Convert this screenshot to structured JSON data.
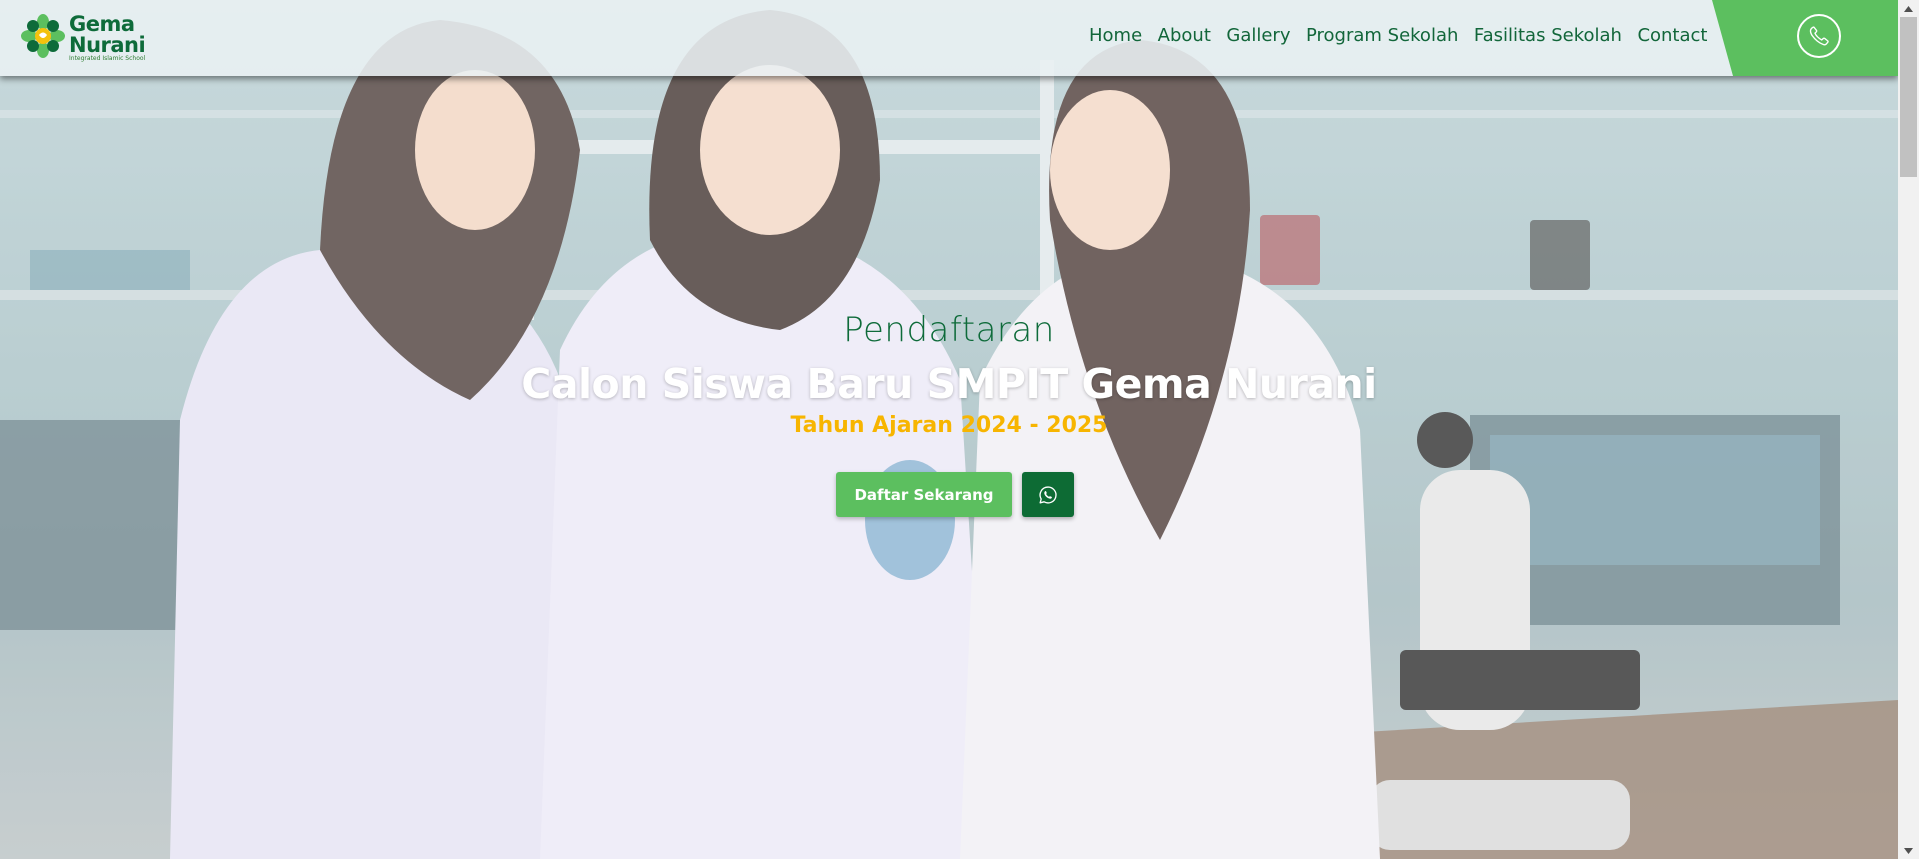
{
  "brand": {
    "name_line1": "Gema",
    "name_line2": "Nurani",
    "tagline": "Integrated Islamic School",
    "color": "#0e6b3a"
  },
  "nav": {
    "items": [
      "Home",
      "About",
      "Gallery",
      "Program Sekolah",
      "Fasilitas Sekolah",
      "Contact"
    ]
  },
  "phone": {
    "icon": "phone-icon",
    "accent": "#5cbf5f"
  },
  "hero": {
    "pre_title": "Pendaftaran",
    "title": "Calon Siswa Baru SMPIT Gema Nurani",
    "subtitle": "Tahun Ajaran 2024 - 2025",
    "subtitle_color": "#f7b500",
    "cta_label": "Daftar Sekarang",
    "cta_color": "#5cbf5f",
    "whatsapp_icon": "whatsapp-icon",
    "whatsapp_color": "#0d6b34"
  }
}
